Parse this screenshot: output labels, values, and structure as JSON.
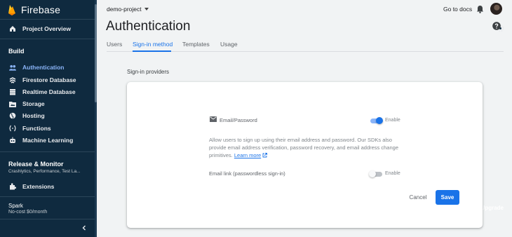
{
  "app": {
    "brand": "Firebase"
  },
  "sidebar": {
    "overview": "Project Overview",
    "build_title": "Build",
    "items": [
      {
        "label": "Authentication",
        "icon": "people-icon",
        "active": true
      },
      {
        "label": "Firestore Database",
        "icon": "firestore-icon"
      },
      {
        "label": "Realtime Database",
        "icon": "database-icon"
      },
      {
        "label": "Storage",
        "icon": "folder-icon"
      },
      {
        "label": "Hosting",
        "icon": "globe-icon"
      },
      {
        "label": "Functions",
        "icon": "functions-icon"
      },
      {
        "label": "Machine Learning",
        "icon": "robot-icon"
      }
    ],
    "release_title": "Release & Monitor",
    "release_sub": "Crashlytics, Performance, Test La...",
    "extensions": "Extensions",
    "plan_name": "Spark",
    "plan_detail": "No-cost $0/month",
    "upgrade": "Upgrade"
  },
  "header": {
    "project": "demo-project",
    "docs": "Go to docs"
  },
  "page": {
    "title": "Authentication",
    "tabs": [
      "Users",
      "Sign-in method",
      "Templates",
      "Usage"
    ],
    "active_tab": "Sign-in method",
    "section_label": "Sign-in providers"
  },
  "providers": {
    "email_password": {
      "label": "Email/Password",
      "enabled": true,
      "toggle_label": "Enable",
      "description": "Allow users to sign up using their email address and password. Our SDKs also provide email address verification, password recovery, and email address change primitives.",
      "learn_more": "Learn more"
    },
    "email_link": {
      "label": "Email link (passwordless sign-in)",
      "enabled": false,
      "toggle_label": "Enable"
    }
  },
  "actions": {
    "cancel": "Cancel",
    "save": "Save"
  },
  "colors": {
    "sidebar_bg": "#0f2a3f",
    "accent": "#1a73e8",
    "active_nav": "#8ab4f8"
  }
}
